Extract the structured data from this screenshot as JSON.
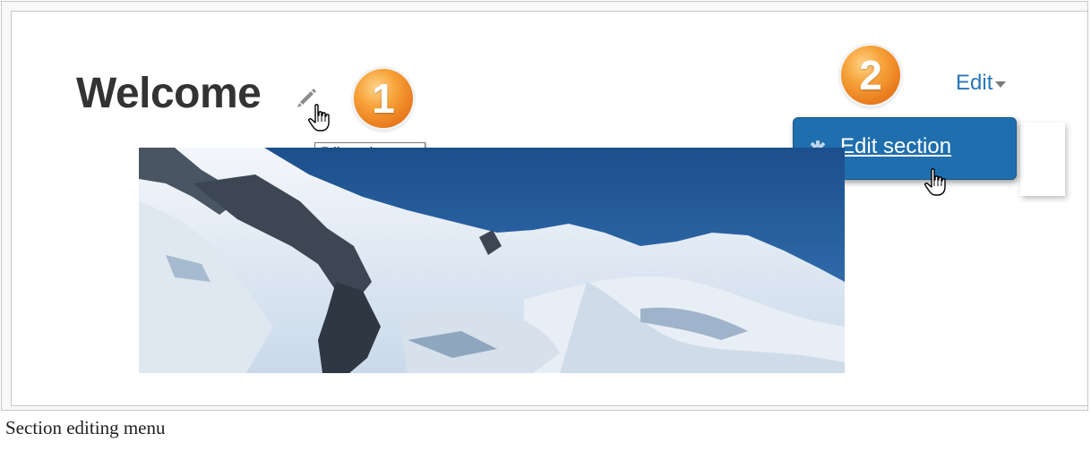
{
  "section": {
    "title": "Welcome",
    "edit_tooltip": "Edit topic name"
  },
  "callouts": {
    "one": "1",
    "two": "2"
  },
  "edit_menu": {
    "toggle_label": "Edit",
    "items": [
      {
        "label": "Edit section",
        "icon": "gear-icon"
      }
    ]
  },
  "image": {
    "description_icon": "mountain-photo"
  },
  "caption": "Section editing menu",
  "colors": {
    "link_blue": "#2a76b8",
    "menu_item_bg": "#1f6fae",
    "badge_orange": "#f28b22",
    "title_text": "#333333"
  }
}
